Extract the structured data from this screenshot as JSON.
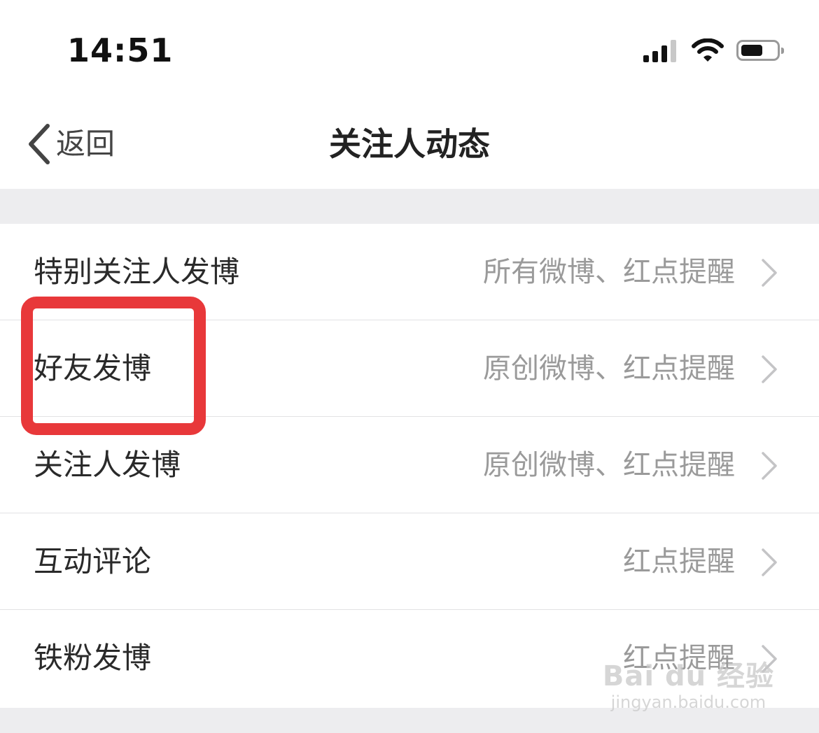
{
  "status_bar": {
    "time": "14:51"
  },
  "nav": {
    "back_label": "返回",
    "title": "关注人动态"
  },
  "settings": {
    "rows": [
      {
        "label": "特别关注人发博",
        "value": "所有微博、红点提醒"
      },
      {
        "label": "好友发博",
        "value": "原创微博、红点提醒"
      },
      {
        "label": "关注人发博",
        "value": "原创微博、红点提醒"
      },
      {
        "label": "互动评论",
        "value": "红点提醒"
      },
      {
        "label": "铁粉发博",
        "value": "红点提醒"
      }
    ]
  },
  "watermark": {
    "logo_text": "Bai du 经验",
    "url": "jingyan.baidu.com"
  },
  "colors": {
    "highlight": "#e8383a",
    "section_gap": "#ededef",
    "secondary_text": "#9a9a9a"
  },
  "icons": [
    "signal-icon",
    "wifi-icon",
    "battery-icon",
    "back-chevron-icon",
    "chevron-right-icon"
  ]
}
